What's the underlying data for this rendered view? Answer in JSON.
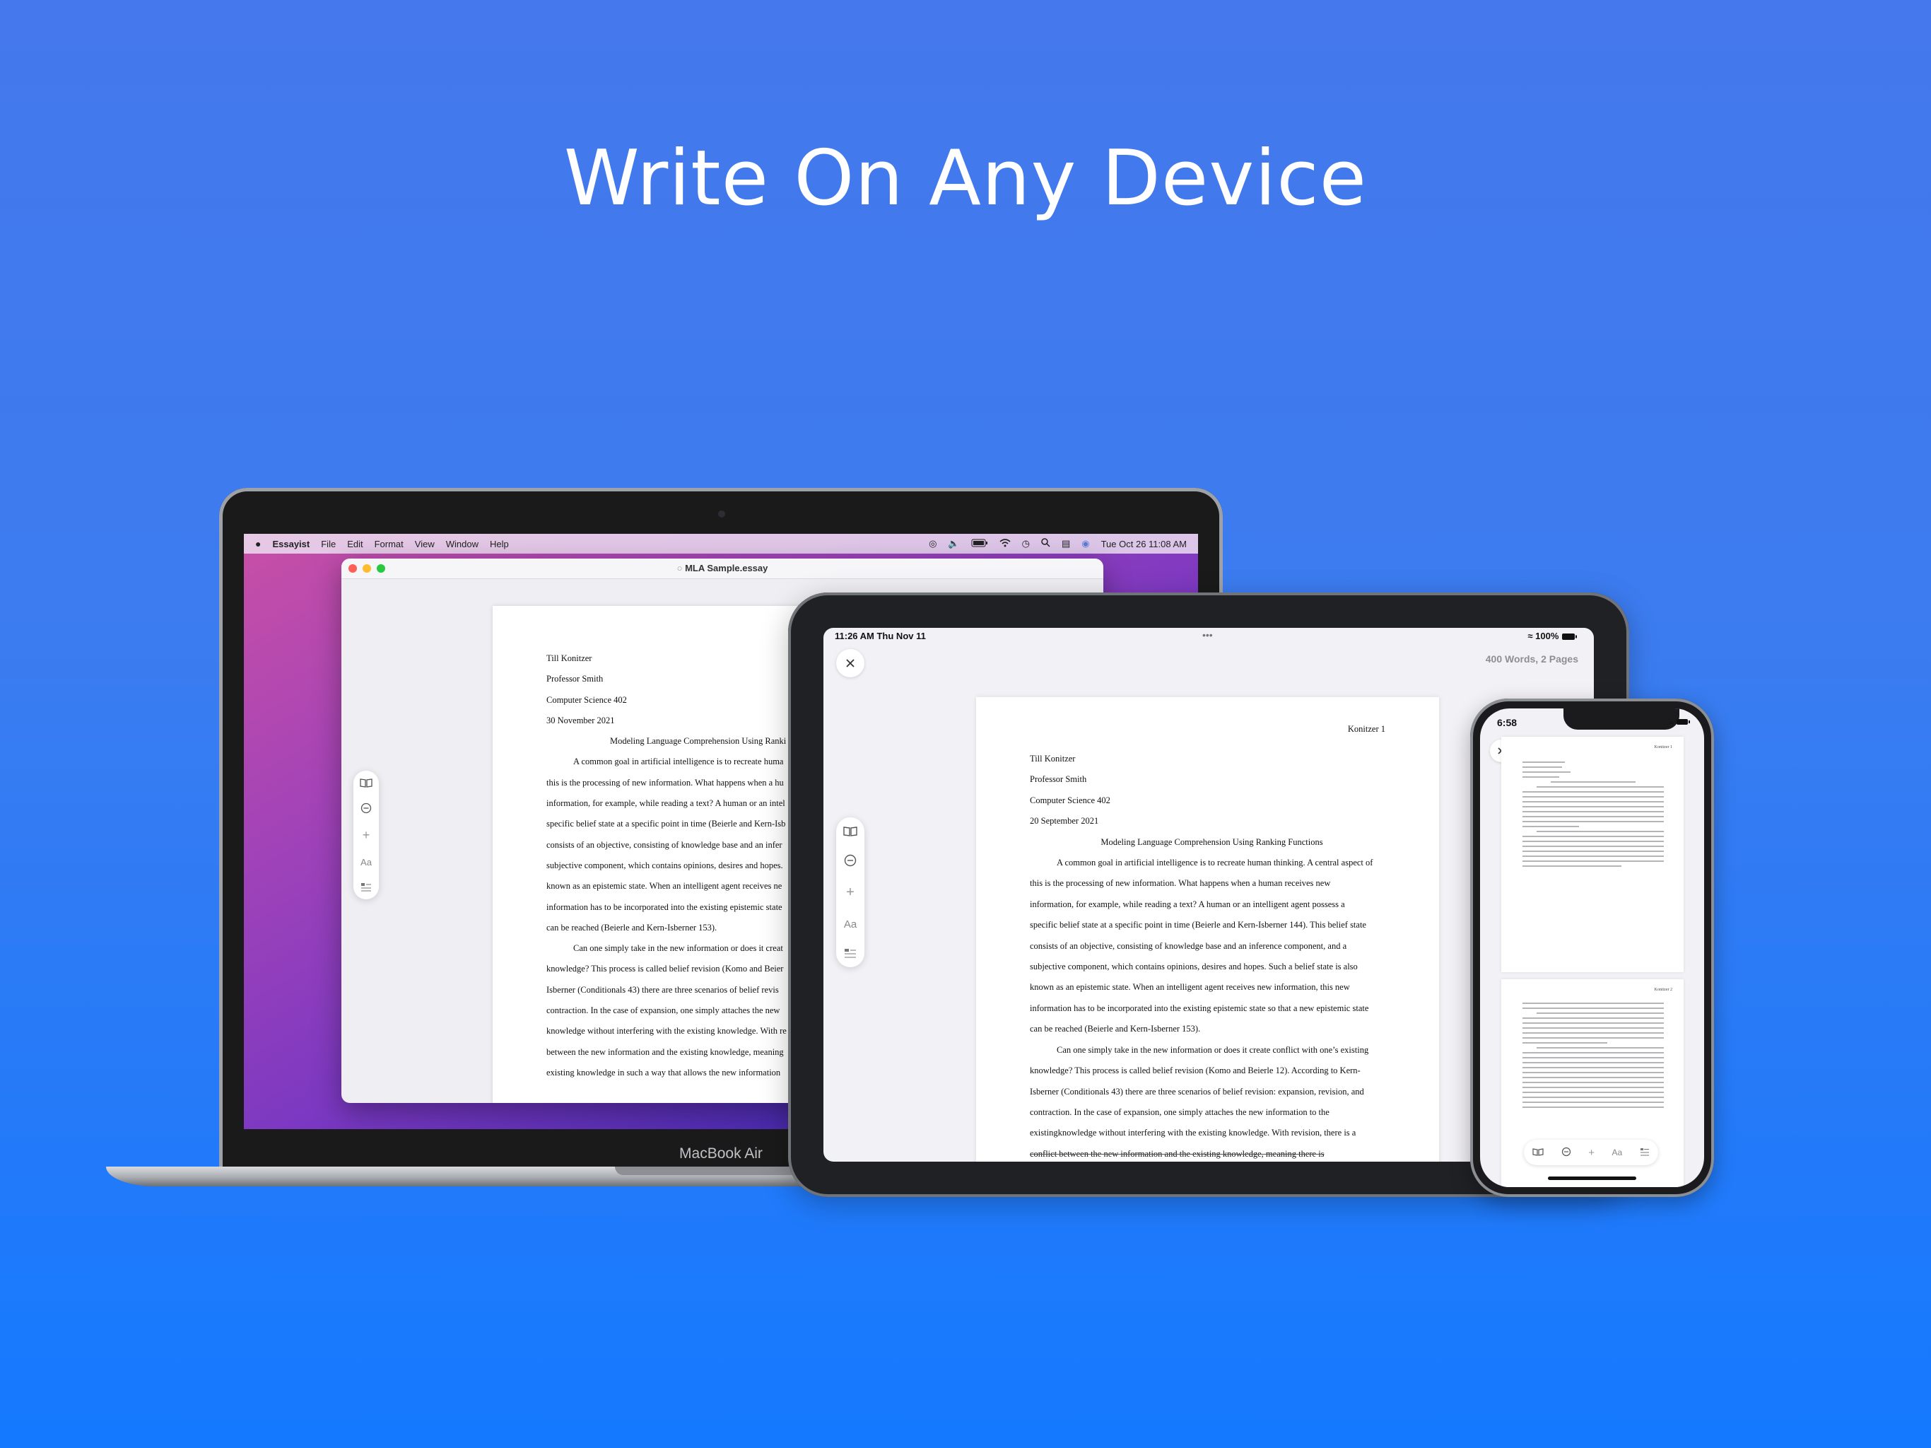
{
  "headline": "Write On Any Device",
  "mac": {
    "device_label": "MacBook Air",
    "menubar": {
      "app": "Essayist",
      "items": [
        "File",
        "Edit",
        "Format",
        "View",
        "Window",
        "Help"
      ],
      "clock": "Tue Oct 26  11:08 AM"
    },
    "window_title": "MLA Sample.essay",
    "document": {
      "header_lines": [
        "Till Konitzer",
        "Professor Smith",
        "Computer Science 402",
        "30 November 2021"
      ],
      "title": "Modeling Language Comprehension Using Ranki",
      "body_lines": [
        "A common goal in artificial intelligence is to recreate huma",
        "this is the processing of new information. What happens when a hu",
        "information, for example, while reading a text? A human or an intel",
        "specific belief state at a specific point in time (Beierle and Kern-Isb",
        "consists of an objective, consisting of knowledge base and an infer",
        "subjective component, which contains opinions, desires and hopes.",
        "known as an epistemic state. When an intelligent agent receives ne",
        "information has to be incorporated into the existing epistemic state",
        "can be reached (Beierle and Kern-Isberner 153).",
        "Can one simply take in the new information or does it creat",
        "knowledge? This process is called belief revision (Komo and Beier",
        "Isberner (Conditionals 43) there are three scenarios of belief revis",
        "contraction. In the case of expansion, one simply attaches the new",
        "knowledge without interfering with the existing knowledge. With re",
        "between the new information and the existing knowledge, meaning",
        "existing knowledge in such a way that allows the new information"
      ]
    }
  },
  "ipad": {
    "status_time": "11:26 AM   Thu Nov 11",
    "status_dots": "•••",
    "status_battery": "100%",
    "word_count": "400 Words, 2 Pages",
    "document": {
      "page_header": "Konitzer 1",
      "header_lines": [
        "Till Konitzer",
        "Professor Smith",
        "Computer Science 402",
        "20 September 2021"
      ],
      "title": "Modeling Language Comprehension Using Ranking Functions",
      "body_lines": [
        "A common goal in artificial intelligence is to recreate human thinking. A central aspect of",
        "this is the processing of new information. What happens when a human receives new",
        "information, for example, while reading a text? A human or an intelligent agent possess a",
        "specific belief state at a specific point in time (Beierle and Kern-Isberner 144). This belief state",
        "consists of an objective, consisting of knowledge base and an inference component, and a",
        "subjective component, which contains opinions, desires and hopes. Such a belief state is also",
        "known as an epistemic state. When an intelligent agent receives new information, this new",
        "information has to be incorporated into the existing epistemic state so that a new epistemic state",
        "can be reached (Beierle and Kern-Isberner 153).",
        "Can one simply take in the new information or does it create conflict with one’s existing",
        "knowledge? This process is called belief revision (Komo and Beierle 12). According to Kern-",
        "Isberner (Conditionals 43) there are three scenarios of belief revision: expansion, revision, and",
        "contraction. In the case of expansion, one simply attaches the new information to the",
        "existingknowledge without interfering with the existing knowledge. With revision, there is a",
        "conflict between the new information and the existing knowledge, meaning there is"
      ]
    }
  },
  "iphone": {
    "status_time": "6:58",
    "page1_header": "Konitzer 1",
    "page2_header": "Konitzer 2",
    "toolbar_font_label": "Aa"
  },
  "toolbar": {
    "font_label": "Aa"
  }
}
